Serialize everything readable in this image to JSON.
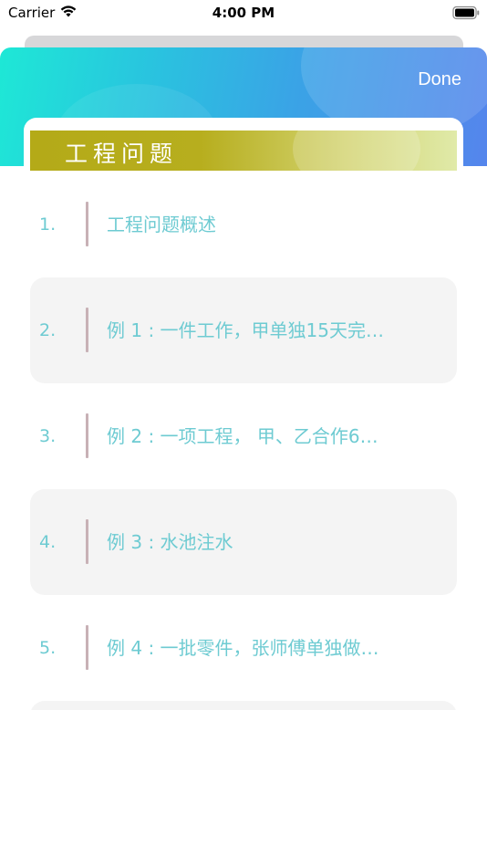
{
  "status_bar": {
    "carrier": "Carrier",
    "time": "4:00 PM"
  },
  "header": {
    "done_label": "Done"
  },
  "section": {
    "title": "工程问题"
  },
  "items": [
    {
      "number": "1.",
      "text": "工程问题概述",
      "shaded": false
    },
    {
      "number": "2.",
      "text": "例 1 : 一件工作，甲单独15天完…",
      "shaded": true
    },
    {
      "number": "3.",
      "text": "例 2 : 一项工程， 甲、乙合作6…",
      "shaded": false
    },
    {
      "number": "4.",
      "text": "例 3 : 水池注水",
      "shaded": true
    },
    {
      "number": "5.",
      "text": "例 4 : 一批零件，张师傅单独做…",
      "shaded": false
    },
    {
      "number": "",
      "text": "",
      "shaded": true
    }
  ],
  "colors": {
    "accent_text": "#6ecbd2",
    "ribbon_start": "#b4aa18",
    "header_gradient": [
      "#1ee8d6",
      "#5585ec"
    ]
  }
}
